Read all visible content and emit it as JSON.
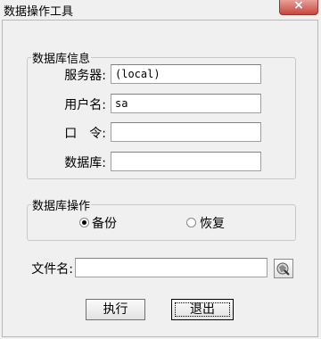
{
  "window": {
    "title": "数据操作工具",
    "close_label": "×"
  },
  "db_info": {
    "legend": "数据库信息",
    "server_label": "服务器:",
    "server_value": "(local)",
    "user_label": "用户名:",
    "user_value": "sa",
    "password_label": "口　令:",
    "password_value": "",
    "database_label": "数据库:",
    "database_value": ""
  },
  "db_ops": {
    "legend": "数据库操作",
    "backup_label": "备份",
    "restore_label": "恢复",
    "selected": "backup"
  },
  "file": {
    "label": "文件名:",
    "value": "",
    "browse_icon": "browse-folder-icon"
  },
  "actions": {
    "execute_label": "执行",
    "exit_label": "退出"
  }
}
